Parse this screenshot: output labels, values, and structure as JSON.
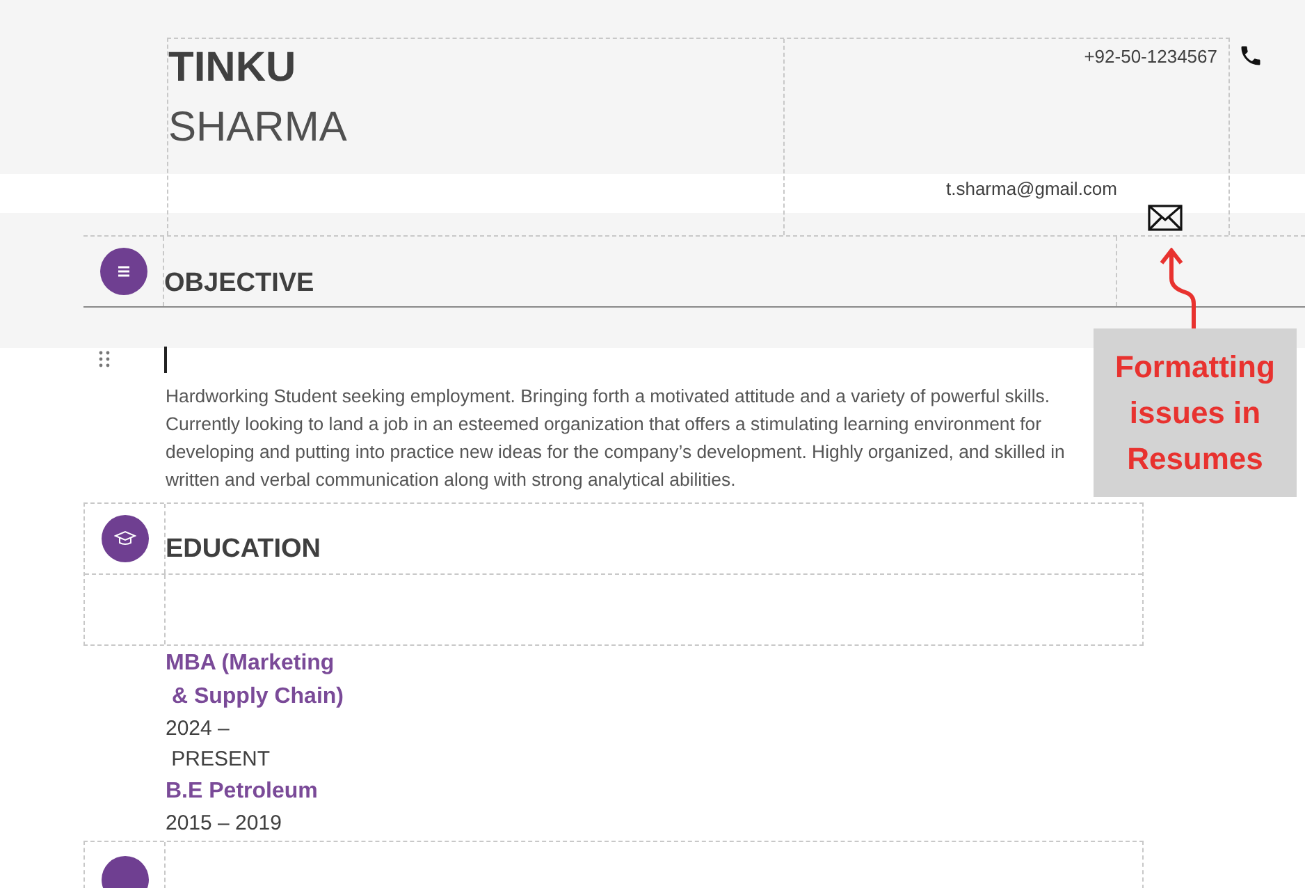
{
  "header": {
    "first_name": "TINKU",
    "last_name": "SHARMA",
    "phone": "+92-50-1234567",
    "email": "t.sharma@gmail.com"
  },
  "objective": {
    "heading": "OBJECTIVE",
    "text": "Hardworking Student seeking employment. Bringing forth a motivated attitude and a variety of powerful skills. Currently looking to land a job in an esteemed organization that offers a stimulating learning environment for developing and putting into practice new ideas for the company’s development. Highly organized, and skilled in written and verbal communication along with strong analytical abilities."
  },
  "education": {
    "heading": "EDUCATION",
    "entries": [
      {
        "kind": "degree",
        "text": "MBA (Marketing"
      },
      {
        "kind": "degree",
        "text": " & Supply Chain)"
      },
      {
        "kind": "date",
        "text": "2024 –"
      },
      {
        "kind": "date",
        "text": " PRESENT"
      },
      {
        "kind": "degree",
        "text": "B.E Petroleum"
      },
      {
        "kind": "date",
        "text": "2015 – 2019"
      }
    ]
  },
  "annotation": {
    "text": "Formatting issues in Resumes"
  }
}
